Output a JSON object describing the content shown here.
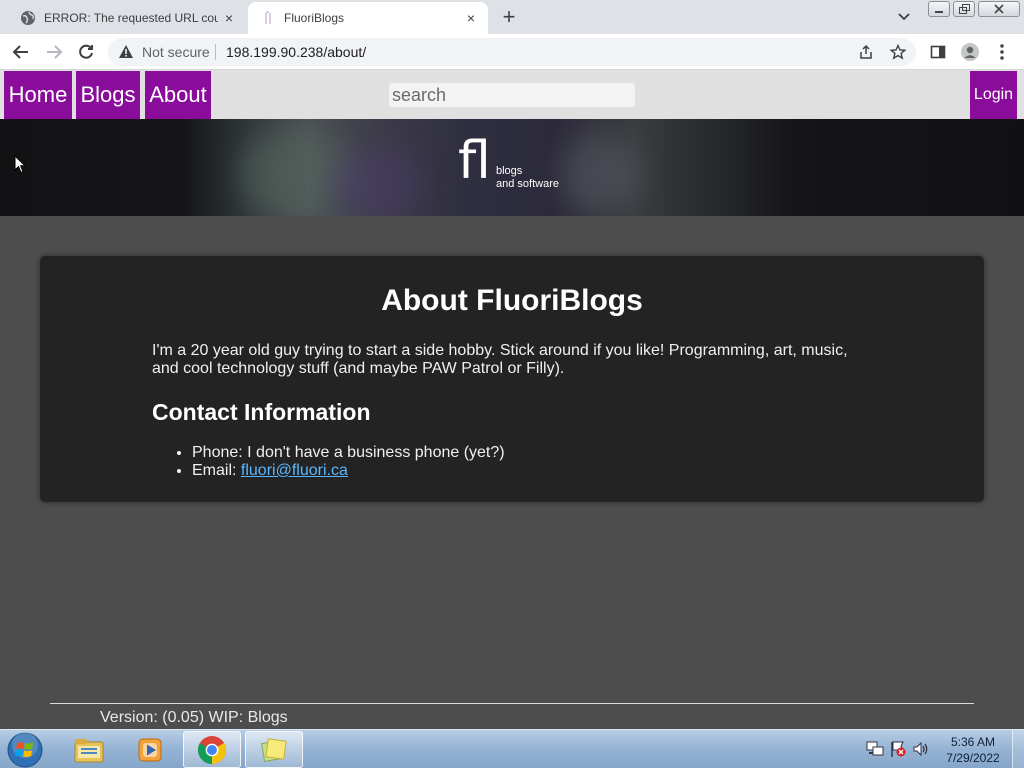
{
  "browser": {
    "tabs": [
      {
        "title": "ERROR: The requested URL could",
        "close": "×"
      },
      {
        "title": "FluoriBlogs",
        "close": "×"
      }
    ],
    "new_tab": "+",
    "address": {
      "security_label": "Not secure",
      "url": "198.199.90.238/about/"
    }
  },
  "site": {
    "nav": {
      "home": "Home",
      "blogs": "Blogs",
      "about": "About",
      "login": "Login"
    },
    "search": {
      "placeholder": "search"
    },
    "banner": {
      "logo_mark": "fl",
      "tagline_1": "blogs",
      "tagline_2": "and software"
    }
  },
  "about": {
    "title": "About FluoriBlogs",
    "intro": "I'm a 20 year old guy trying to start a side hobby. Stick around if you like! Programming, art, music, and cool technology stuff (and maybe PAW Patrol or Filly).",
    "contact_heading": "Contact Information",
    "phone": "Phone: I don't have a business phone (yet?)",
    "email_label": "Email: ",
    "email": "fluori@fluori.ca"
  },
  "footer": {
    "version": "Version: (0.05) WIP: Blogs"
  },
  "taskbar": {
    "apps": [
      "windows-explorer-icon",
      "media-player-icon",
      "chrome-icon",
      "sticky-notes-icon"
    ],
    "clock": {
      "time": "5:36 AM",
      "date": "7/29/2022"
    }
  },
  "colors": {
    "nav_purple": "#8a0c9a",
    "link_blue": "#59b7ff",
    "card_bg": "#232323",
    "page_bg": "#4d4d4d"
  }
}
